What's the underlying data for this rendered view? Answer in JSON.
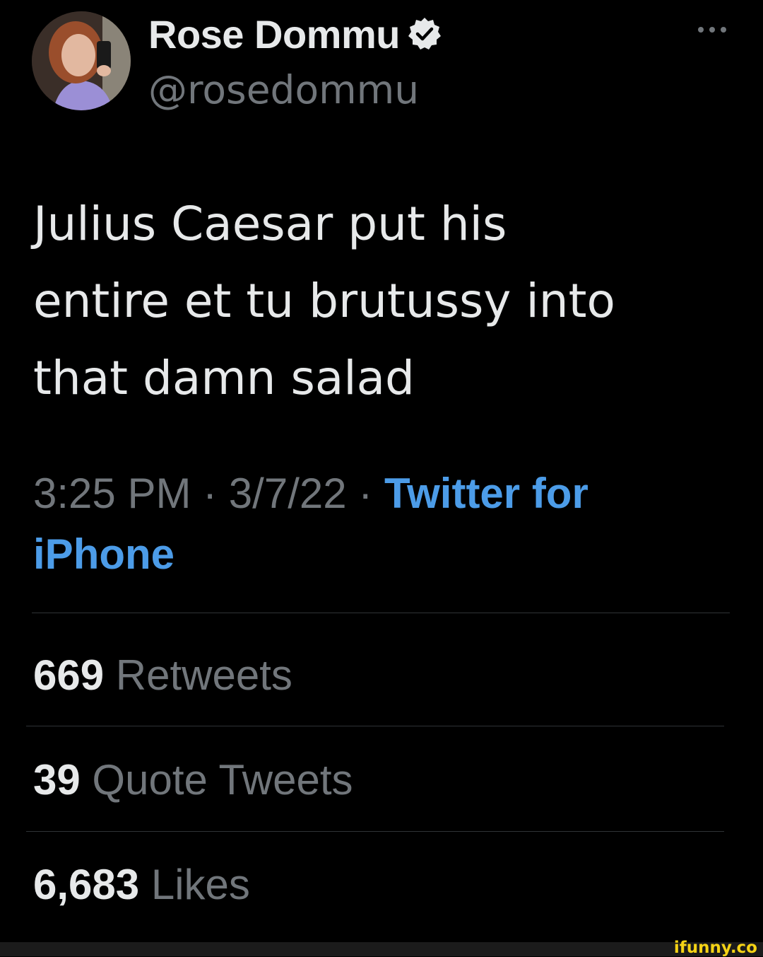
{
  "author": {
    "display_name": "Rose Dommu",
    "handle": "@rosedommu",
    "verified": true
  },
  "tweet": {
    "text": "Julius Caesar put his\nentire et tu brutussy into\nthat damn salad",
    "time": "3:25 PM",
    "date": "3/7/22",
    "separator": "·",
    "source": "Twitter for iPhone"
  },
  "stats": {
    "retweets": {
      "count": "669",
      "label": "Retweets"
    },
    "quote_tweets": {
      "count": "39",
      "label": "Quote Tweets"
    },
    "likes": {
      "count": "6,683",
      "label": "Likes"
    }
  },
  "watermark": "ifunny.co",
  "colors": {
    "background": "#000000",
    "text_primary": "#e7e9ea",
    "text_secondary": "#71767b",
    "link": "#4c9ce8",
    "divider": "#2f3336",
    "watermark": "#f5d315"
  },
  "icons": {
    "verified": "verified-badge-icon",
    "more": "more-options-icon"
  }
}
